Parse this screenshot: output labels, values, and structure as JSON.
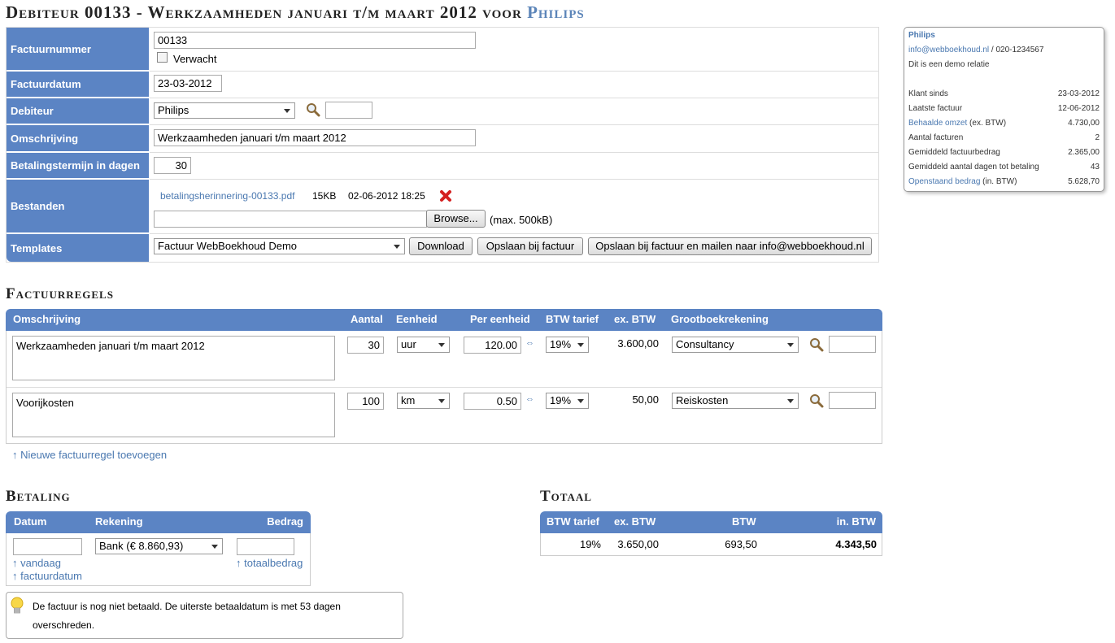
{
  "page": {
    "title_prefix": "Debiteur 00133 - Werkzaamheden januari t/m maart 2012 voor ",
    "title_client": "Philips"
  },
  "form": {
    "factuurnummer_label": "Factuurnummer",
    "factuurnummer_value": "00133",
    "verwacht_label": "Verwacht",
    "factuurdatum_label": "Factuurdatum",
    "factuurdatum_value": "23-03-2012",
    "debiteur_label": "Debiteur",
    "debiteur_value": "Philips",
    "omschrijving_label": "Omschrijving",
    "omschrijving_value": "Werkzaamheden januari t/m maart 2012",
    "betalingstermijn_label": "Betalingstermijn in dagen",
    "betalingstermijn_value": "30",
    "bestanden_label": "Bestanden",
    "file_name": "betalingsherinnering-00133.pdf",
    "file_size": "15KB",
    "file_date": "02-06-2012 18:25",
    "browse_label": "Browse...",
    "max_label": "(max. 500kB)",
    "templates_label": "Templates",
    "template_value": "Factuur WebBoekhoud Demo",
    "download_label": "Download",
    "opslaan_label": "Opslaan bij factuur",
    "opslaan_mailen_label": "Opslaan bij factuur en mailen naar info@webboekhoud.nl"
  },
  "info": {
    "name": "Philips",
    "email": "info@webboekhoud.nl",
    "phone_sep": " / 020-1234567",
    "note": "Dit is een demo relatie",
    "rows": [
      {
        "label": "Klant sinds",
        "suffix": "",
        "value": "23-03-2012",
        "link": false
      },
      {
        "label": "Laatste factuur",
        "suffix": "",
        "value": "12-06-2012",
        "link": false
      },
      {
        "label": "Behaalde omzet",
        "suffix": " (ex. BTW)",
        "value": "4.730,00",
        "link": true
      },
      {
        "label": "Aantal facturen",
        "suffix": "",
        "value": "2",
        "link": false
      },
      {
        "label": "Gemiddeld factuurbedrag",
        "suffix": "",
        "value": "2.365,00",
        "link": false
      },
      {
        "label": "Gemiddeld aantal dagen tot betaling",
        "suffix": "",
        "value": "43",
        "link": false
      },
      {
        "label": "Openstaand bedrag",
        "suffix": " (in. BTW)",
        "value": "5.628,70",
        "link": true
      }
    ]
  },
  "factuurregels": {
    "heading": "Factuurregels",
    "headers": {
      "omschrijving": "Omschrijving",
      "aantal": "Aantal",
      "eenheid": "Eenheid",
      "per_eenheid": "Per eenheid",
      "btw_tarief": "BTW tarief",
      "ex_btw": "ex. BTW",
      "grootboek": "Grootboekrekening"
    },
    "rows": [
      {
        "omschrijving": "Werkzaamheden januari t/m maart 2012",
        "aantal": "30",
        "eenheid": "uur",
        "per_eenheid": "120.00",
        "btw": "19%",
        "ex_btw": "3.600,00",
        "grootboek": "Consultancy"
      },
      {
        "omschrijving": "Voorijkosten",
        "aantal": "100",
        "eenheid": "km",
        "per_eenheid": "0.50",
        "btw": "19%",
        "ex_btw": "50,00",
        "grootboek": "Reiskosten"
      }
    ],
    "add_link": "↑ Nieuwe factuurregel toevoegen"
  },
  "betaling": {
    "heading": "Betaling",
    "headers": {
      "datum": "Datum",
      "rekening": "Rekening",
      "bedrag": "Bedrag"
    },
    "rekening_value": "Bank (€ 8.860,93)",
    "vandaag_link": "↑ vandaag",
    "factuurdatum_link": "↑ factuurdatum",
    "totaalbedrag_link": "↑ totaalbedrag",
    "notice": "De factuur is nog niet betaald. De uiterste betaaldatum is met 53 dagen overschreden."
  },
  "totaal": {
    "heading": "Totaal",
    "headers": {
      "btw_tarief": "BTW tarief",
      "ex_btw": "ex. BTW",
      "btw": "BTW",
      "in_btw": "in. BTW"
    },
    "row": {
      "btw_tarief": "19%",
      "ex_btw": "3.650,00",
      "btw": "693,50",
      "in_btw": "4.343,50"
    }
  }
}
